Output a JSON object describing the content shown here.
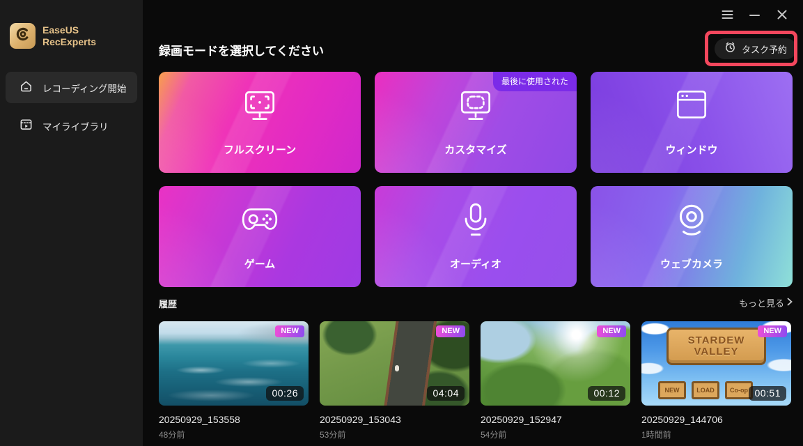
{
  "app": {
    "brand_line1": "EaseUS",
    "brand_line2": "RecExperts"
  },
  "sidebar": {
    "items": [
      {
        "label": "レコーディング開始",
        "active": true
      },
      {
        "label": "マイライブラリ",
        "active": false
      }
    ]
  },
  "header": {
    "title": "録画モードを選択してください",
    "task_button_label": "タスク予約"
  },
  "modes": [
    {
      "label": "フルスクリーン"
    },
    {
      "label": "カスタマイズ",
      "badge": "最後に使用された"
    },
    {
      "label": "ウィンドウ"
    },
    {
      "label": "ゲーム"
    },
    {
      "label": "オーディオ"
    },
    {
      "label": "ウェブカメラ"
    }
  ],
  "history": {
    "title": "履歴",
    "more_label": "もっと見る",
    "items": [
      {
        "name": "20250929_153558",
        "time": "48分前",
        "duration": "00:26",
        "badge": "NEW"
      },
      {
        "name": "20250929_153043",
        "time": "53分前",
        "duration": "04:04",
        "badge": "NEW"
      },
      {
        "name": "20250929_152947",
        "time": "54分前",
        "duration": "00:12",
        "badge": "NEW"
      },
      {
        "name": "20250929_144706",
        "time": "1時間前",
        "duration": "00:51",
        "badge": "NEW",
        "game": {
          "title_line1": "STARDEW",
          "title_line2": "VALLEY",
          "buttons": [
            "NEW",
            "LOAD",
            "Co-op"
          ]
        }
      }
    ]
  },
  "colors": {
    "annotation_red": "#F4475D",
    "last_used_badge_purple": "#7B2BE8",
    "new_badge_gradient_from": "#EF4ED6",
    "new_badge_gradient_to": "#8D4BF0",
    "brand_gold": "#E6C289",
    "sidebar_bg": "#1B1B1B",
    "main_bg": "#0A0A0A"
  }
}
